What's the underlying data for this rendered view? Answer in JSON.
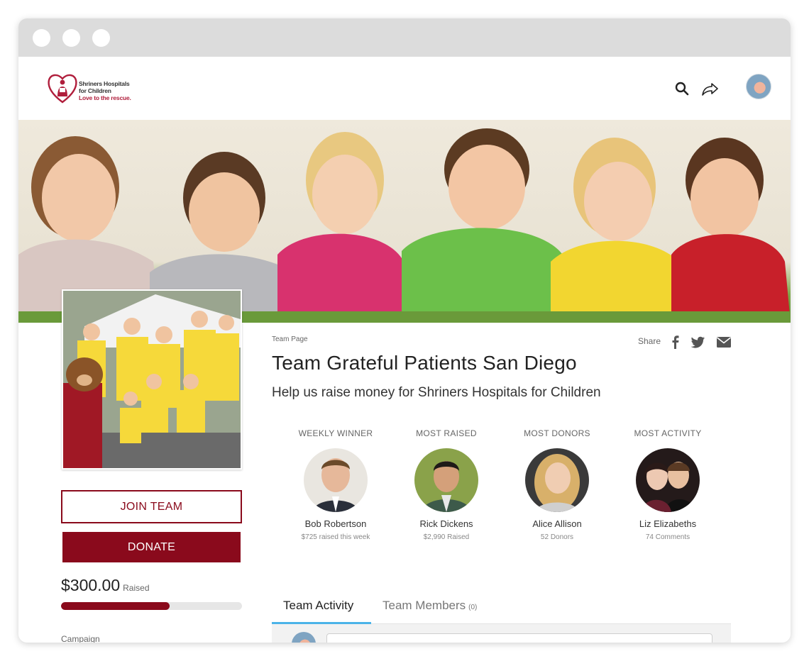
{
  "org": {
    "name_line1": "Shriners Hospitals",
    "name_line2": "for Children",
    "tagline": "Love to the rescue."
  },
  "nav": {
    "icons": [
      "search-icon",
      "share-arrow-icon"
    ]
  },
  "breadcrumb": "Team Page",
  "page": {
    "title": "Team Grateful Patients San Diego",
    "subtitle": "Help us raise money for Shriners Hospitals for Children"
  },
  "share": {
    "label": "Share",
    "icons": [
      "facebook-icon",
      "twitter-icon",
      "email-icon"
    ]
  },
  "actions": {
    "join_label": "JOIN TEAM",
    "donate_label": "DONATE"
  },
  "fundraising": {
    "amount": "$300.00",
    "raised_label": "Raised",
    "progress_fraction": 0.6
  },
  "campaign_label": "Campaign",
  "leaders": [
    {
      "category": "WEEKLY WINNER",
      "name": "Bob Robertson",
      "stat": "$725 raised this week"
    },
    {
      "category": "MOST RAISED",
      "name": "Rick Dickens",
      "stat": "$2,990 Raised"
    },
    {
      "category": "MOST DONORS",
      "name": "Alice Allison",
      "stat": "52 Donors"
    },
    {
      "category": "MOST ACTIVITY",
      "name": "Liz Elizabeths",
      "stat": "74 Comments"
    }
  ],
  "tabs": [
    {
      "label": "Team Activity",
      "active": true
    },
    {
      "label": "Team Members",
      "count": "(0)",
      "active": false
    }
  ],
  "colors": {
    "brand": "#8a0a1c",
    "tab_accent": "#4bb3e8",
    "titlebar": "#dcdcdc"
  }
}
